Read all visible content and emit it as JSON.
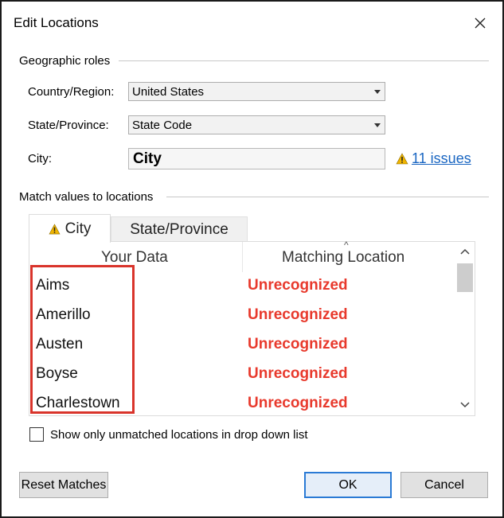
{
  "dialog": {
    "title": "Edit Locations"
  },
  "geographic_roles": {
    "heading": "Geographic roles",
    "country_label": "Country/Region:",
    "country_value": "United States",
    "state_label": "State/Province:",
    "state_value": "State Code",
    "city_label": "City:",
    "city_value": "City",
    "issues_text": "11 issues"
  },
  "match": {
    "heading": "Match values to locations",
    "tabs": [
      {
        "label": "City",
        "active": true,
        "icon": "warning-icon"
      },
      {
        "label": "State/Province",
        "active": false
      }
    ],
    "columns": [
      "Your Data",
      "Matching Location"
    ],
    "rows": [
      {
        "your_data": "Aims",
        "matching": "Unrecognized"
      },
      {
        "your_data": "Amerillo",
        "matching": "Unrecognized"
      },
      {
        "your_data": "Austen",
        "matching": "Unrecognized"
      },
      {
        "your_data": "Boyse",
        "matching": "Unrecognized"
      },
      {
        "your_data": "Charlestown",
        "matching": "Unrecognized"
      }
    ]
  },
  "options": {
    "show_unmatched_label": "Show only unmatched locations in drop down list",
    "show_unmatched_checked": false
  },
  "buttons": {
    "reset": "Reset Matches",
    "ok": "OK",
    "cancel": "Cancel"
  },
  "colors": {
    "unrecognized": "#e8392c",
    "highlight_box": "#d9342b",
    "link": "#1a66c2",
    "warning": "#f0b400"
  }
}
